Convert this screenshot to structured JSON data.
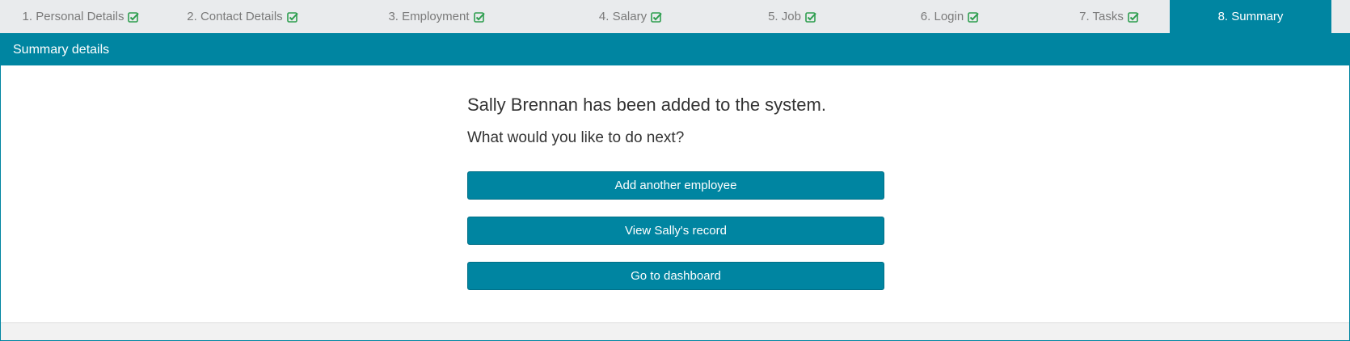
{
  "colors": {
    "accent": "#0085a1",
    "check": "#2e9e4f",
    "tab_bg": "#e9ebed"
  },
  "tabs": [
    {
      "label": "1. Personal Details",
      "complete": true,
      "icon": "check-square-icon"
    },
    {
      "label": "2. Contact Details",
      "complete": true,
      "icon": "check-square-icon"
    },
    {
      "label": "3. Employment",
      "complete": true,
      "icon": "check-square-icon"
    },
    {
      "label": "4. Salary",
      "complete": true,
      "icon": "check-square-icon"
    },
    {
      "label": "5. Job",
      "complete": true,
      "icon": "check-square-icon"
    },
    {
      "label": "6. Login",
      "complete": true,
      "icon": "check-square-icon"
    },
    {
      "label": "7. Tasks",
      "complete": true,
      "icon": "check-square-icon"
    },
    {
      "label": "8. Summary",
      "active": true
    }
  ],
  "panel": {
    "title": "Summary details"
  },
  "summary": {
    "message": "Sally Brennan has been added to the system.",
    "prompt": "What would you like to do next?",
    "buttons": {
      "add_employee": "Add another employee",
      "view_record": "View Sally's record",
      "dashboard": "Go to dashboard"
    }
  }
}
